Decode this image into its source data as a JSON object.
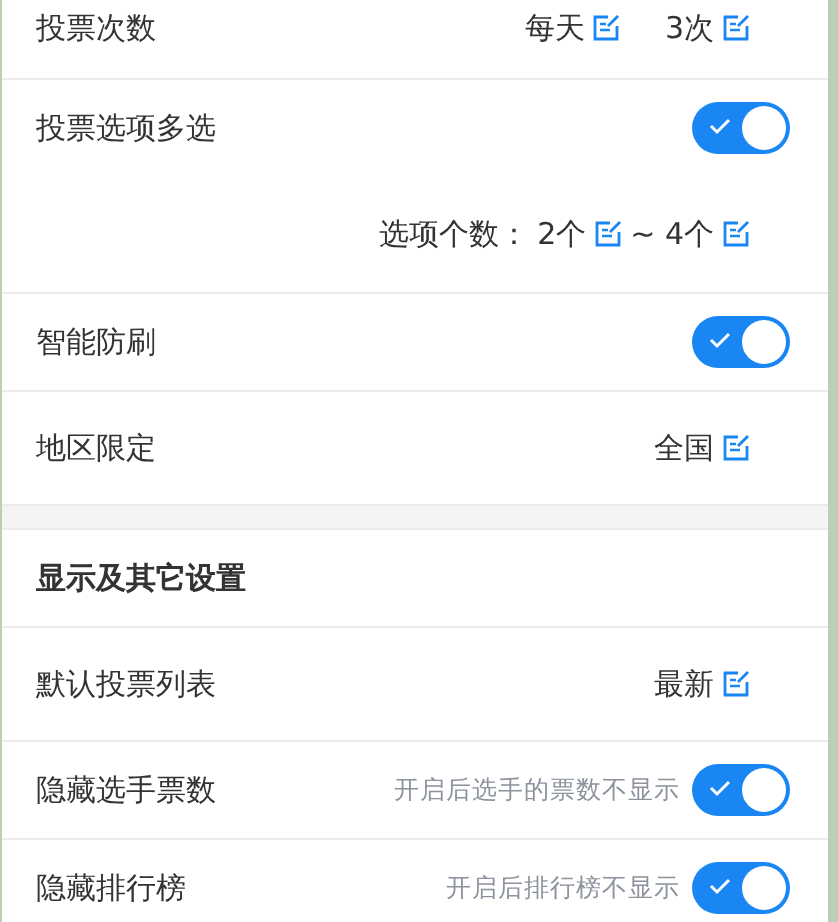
{
  "groups": [
    {
      "rows": [
        {
          "kind": "values",
          "label": "投票次数",
          "values": [
            "每天",
            "3次"
          ]
        },
        {
          "kind": "toggle",
          "label": "投票选项多选",
          "on": true,
          "detail": {
            "label": "选项个数：",
            "values": [
              "2个",
              "~ 4个"
            ]
          }
        },
        {
          "kind": "toggle",
          "label": "智能防刷",
          "on": true
        },
        {
          "kind": "values",
          "label": "地区限定",
          "values": [
            "全国"
          ]
        }
      ]
    },
    {
      "header": "显示及其它设置",
      "rows": [
        {
          "kind": "values",
          "label": "默认投票列表",
          "values": [
            "最新"
          ]
        },
        {
          "kind": "toggle",
          "label": "隐藏选手票数",
          "on": true,
          "hint": "开启后选手的票数不显示"
        },
        {
          "kind": "toggle",
          "label": "隐藏排行榜",
          "on": true,
          "hint": "开启后排行榜不显示"
        }
      ]
    }
  ]
}
